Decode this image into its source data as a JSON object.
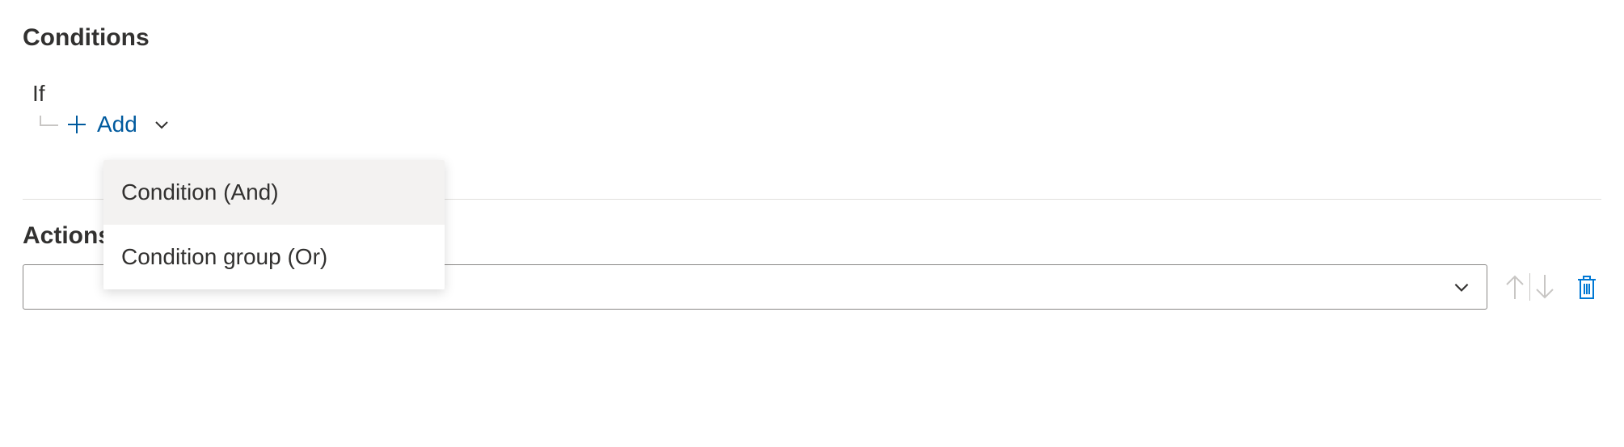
{
  "conditions": {
    "title": "Conditions",
    "if_label": "If",
    "add_label": "Add",
    "menu": {
      "condition_and": "Condition (And)",
      "condition_group_or": "Condition group (Or)"
    }
  },
  "actions": {
    "title": "Actions",
    "selected": ""
  },
  "colors": {
    "link": "#005A9E",
    "delete_icon": "#0078D4",
    "disabled": "#c8c6c4"
  }
}
